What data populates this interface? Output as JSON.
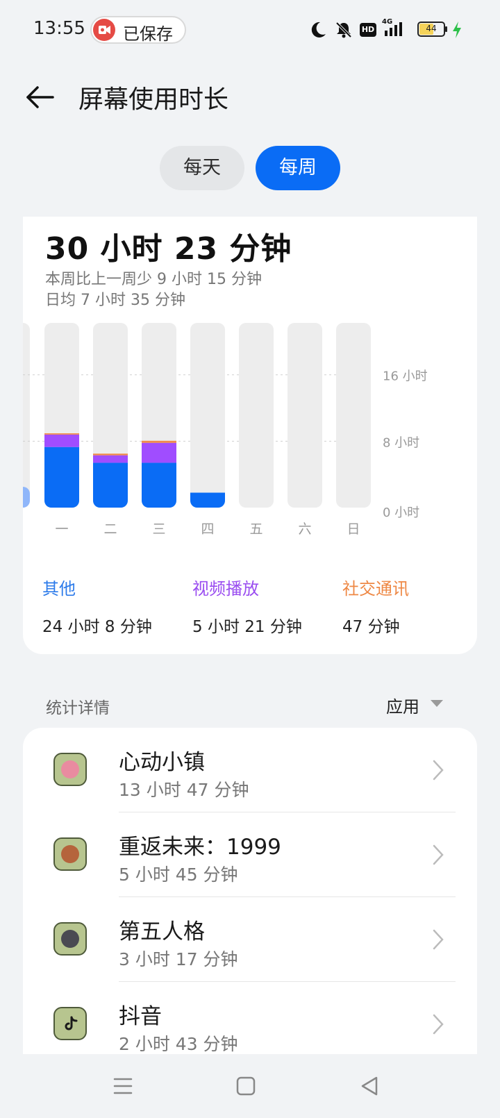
{
  "status_bar": {
    "time": "13:55",
    "recording_label": "已保存",
    "recording_icon": "video-record-icon",
    "icons": [
      "moon-icon",
      "bell-muted-icon",
      "hd-icon",
      "signal-4g-icon",
      "battery-icon",
      "charging-icon"
    ],
    "network_label": "4G",
    "hd_label": "HD",
    "battery_level": "44"
  },
  "header": {
    "back_icon": "arrow-left-icon",
    "title": "屏幕使用时长"
  },
  "period_tabs": [
    {
      "label": "每天",
      "selected": false
    },
    {
      "label": "每周",
      "selected": true
    }
  ],
  "summary": {
    "total": "30 小时 23 分钟",
    "compare": "本周比上一周少 9 小时 15 分钟",
    "average": "日均 7 小时 35 分钟"
  },
  "chart_data": {
    "type": "bar",
    "stacked": true,
    "categories": [
      "一",
      "二",
      "三",
      "四",
      "五",
      "六",
      "日"
    ],
    "series": [
      {
        "name": "其他",
        "color": "#0A6CF5",
        "values": [
          7.3,
          5.4,
          5.4,
          1.8,
          0,
          0,
          0
        ]
      },
      {
        "name": "视频播放",
        "color": "#A04DFF",
        "values": [
          1.5,
          0.9,
          2.4,
          0,
          0,
          0,
          0
        ]
      },
      {
        "name": "社交通讯",
        "color": "#F08A4B",
        "values": [
          0.15,
          0.2,
          0.25,
          0,
          0,
          0,
          0
        ]
      }
    ],
    "yticks": [
      "0 小时",
      "8 小时",
      "16 小时"
    ],
    "ytick_values": [
      0,
      8,
      16
    ],
    "ylim": [
      0,
      23
    ],
    "grid": true
  },
  "legend": [
    {
      "name": "其他",
      "value": "24 小时 8 分钟",
      "color": "#0A6CF5"
    },
    {
      "name": "视频播放",
      "value": "5 小时 21 分钟",
      "color": "#A04DFF"
    },
    {
      "name": "社交通讯",
      "value": "47 分钟",
      "color": "#F08A4B"
    }
  ],
  "stats": {
    "label": "统计详情",
    "filter_label": "应用"
  },
  "apps": [
    {
      "name": "心动小镇",
      "time": "13 小时 47 分钟",
      "icon": "heartopia-app-icon",
      "color": "#E98BA0"
    },
    {
      "name": "重返未来：1999",
      "time": "5 小时 45 分钟",
      "icon": "reverse-1999-app-icon",
      "color": "#B5643C"
    },
    {
      "name": "第五人格",
      "time": "3 小时 17 分钟",
      "icon": "identity-v-app-icon",
      "color": "#4A4A52"
    },
    {
      "name": "抖音",
      "time": "2 小时 43 分钟",
      "icon": "douyin-app-icon",
      "color": "#1B1B1B"
    }
  ],
  "nav_bar": {
    "buttons": [
      "menu-icon",
      "home-square-icon",
      "back-triangle-icon"
    ]
  }
}
